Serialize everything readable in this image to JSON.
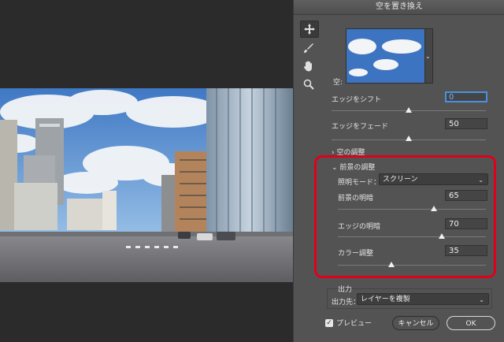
{
  "dialog": {
    "title": "空を置き換え",
    "sky_label": "空:",
    "edge_shift": {
      "label": "エッジをシフト",
      "value": "0",
      "level": 0.5
    },
    "edge_fade": {
      "label": "エッジをフェード",
      "value": "50",
      "level": 0.5
    },
    "sky_adjust_label": "空の調整",
    "foreground_adjust": {
      "label": "前景の調整",
      "lighting_mode_label": "照明モード：",
      "lighting_mode_value": "スクリーン",
      "foreground_lighting": {
        "label": "前景の明暗",
        "value": "65",
        "level": 0.65
      },
      "edge_lighting": {
        "label": "エッジの明暗",
        "value": "70",
        "level": 0.7
      },
      "color_adjust": {
        "label": "カラー調整",
        "value": "35",
        "level": 0.35
      }
    },
    "output": {
      "label": "出力",
      "dest_label": "出力先：",
      "dest_value": "レイヤーを複製"
    },
    "preview_label": "プレビュー",
    "cancel_label": "キャンセル",
    "ok_label": "OK"
  },
  "colors": {
    "highlight": "#e0001b",
    "focus": "#4a90e2",
    "panel": "#535353"
  },
  "icons": [
    "move-icon",
    "brush-icon",
    "hand-icon",
    "zoom-icon",
    "chevron-down-icon",
    "chevron-right-icon",
    "checkbox-checked-icon"
  ]
}
